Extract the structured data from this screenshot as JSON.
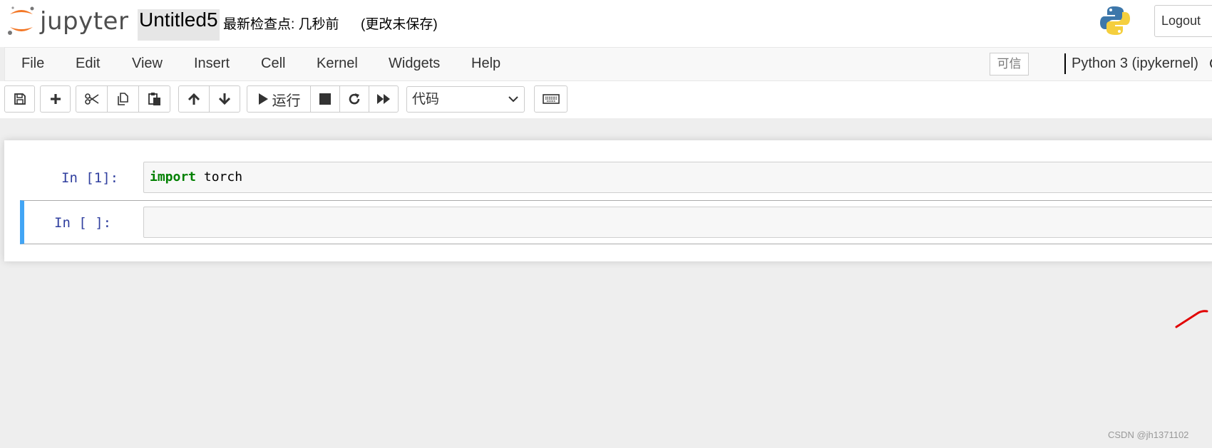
{
  "header": {
    "logo_text": "jupyter",
    "notebook_name": "Untitled5",
    "checkpoint": "最新检查点: 几秒前",
    "autosave_status": "(更改未保存)",
    "logout_label": "Logout"
  },
  "menubar": {
    "items": [
      "File",
      "Edit",
      "View",
      "Insert",
      "Cell",
      "Kernel",
      "Widgets",
      "Help"
    ],
    "trusted_label": "可信",
    "kernel_name": "Python 3 (ipykernel)"
  },
  "toolbar": {
    "run_label": "运行",
    "cell_type": "代码",
    "icons": [
      "save-icon",
      "plus-icon",
      "cut-icon",
      "copy-icon",
      "paste-icon",
      "arrow-up-icon",
      "arrow-down-icon",
      "play-icon",
      "stop-icon",
      "restart-icon",
      "fast-forward-icon",
      "keyboard-icon"
    ]
  },
  "cells": [
    {
      "prompt": "In  [1]:",
      "keyword": "import",
      "code": " torch"
    },
    {
      "prompt": "In  [ ]:",
      "keyword": "",
      "code": ""
    }
  ],
  "colors": {
    "keyword": "#008000",
    "prompt": "#303f9f",
    "selected_cell_accent": "#42a5f5",
    "logo_orange": "#f37726"
  },
  "watermark": "CSDN @jh1371102"
}
